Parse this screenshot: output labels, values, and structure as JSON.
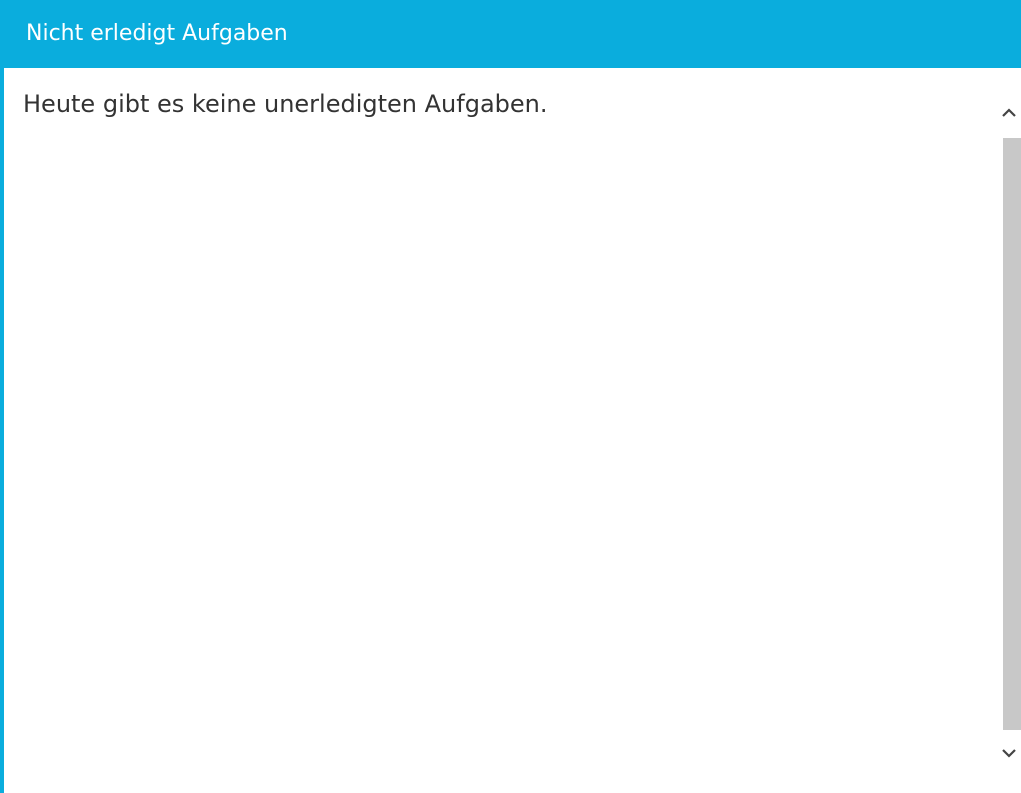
{
  "panel": {
    "title": "Nicht erledigt Aufgaben",
    "empty_message": "Heute gibt es keine unerledigten Aufgaben."
  },
  "scrollbar": {
    "up_icon": "chevron-up-icon",
    "down_icon": "chevron-down-icon"
  },
  "colors": {
    "accent": "#0aaddd",
    "text": "#333333",
    "scroll_thumb": "#c8c8c8"
  }
}
